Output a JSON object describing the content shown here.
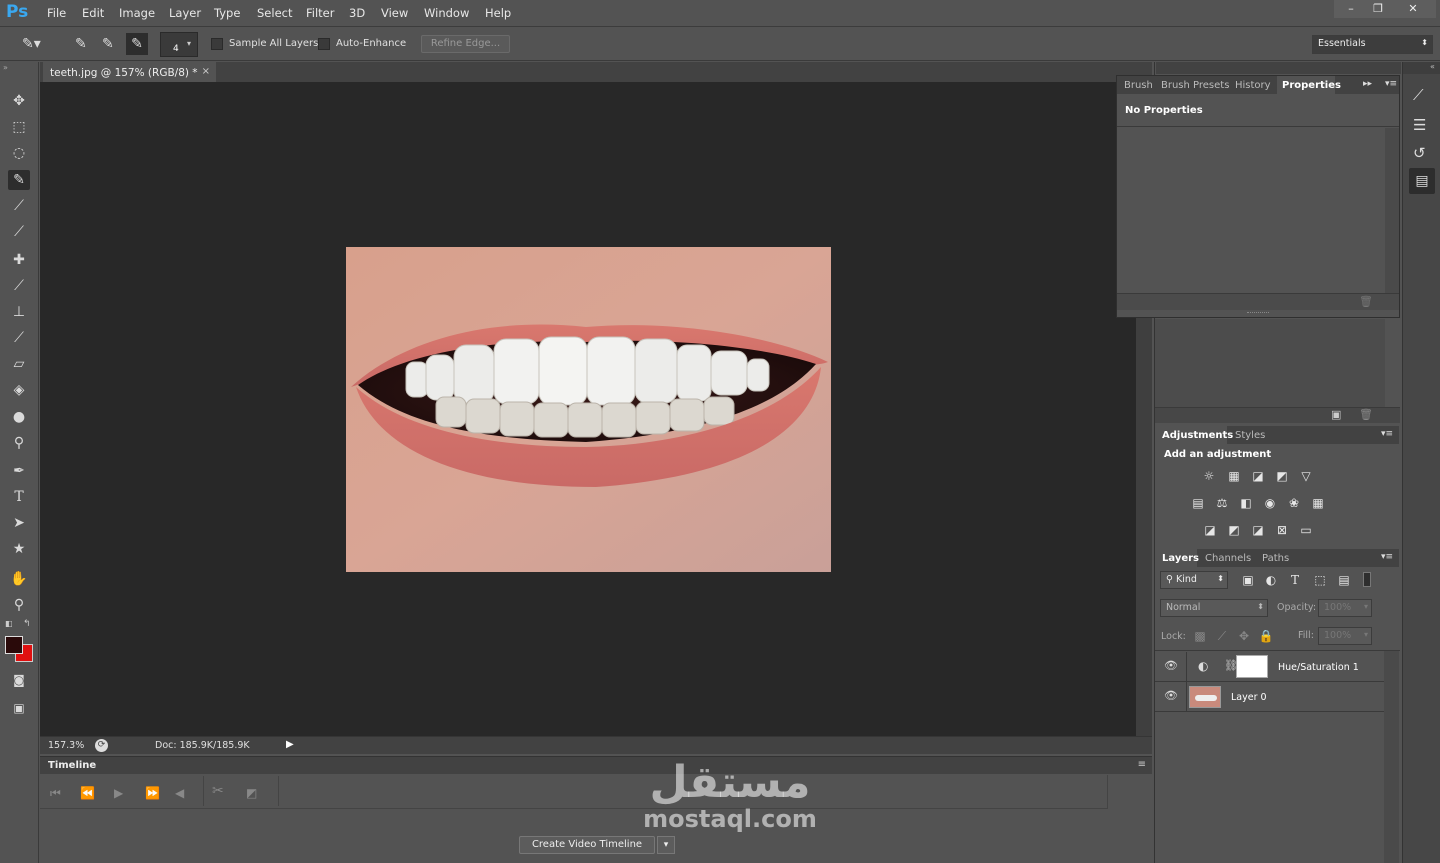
{
  "app": {
    "logo": "Ps"
  },
  "menu": [
    "File",
    "Edit",
    "Image",
    "Layer",
    "Type",
    "Select",
    "Filter",
    "3D",
    "View",
    "Window",
    "Help"
  ],
  "window_controls": {
    "minimize": "–",
    "restore": "❐",
    "close": "✕"
  },
  "options": {
    "brush_size": "4",
    "sample_all_layers": "Sample All Layers",
    "auto_enhance": "Auto-Enhance",
    "refine_edge": "Refine Edge...",
    "workspace": "Essentials"
  },
  "document": {
    "tab_title": "teeth.jpg @ 157% (RGB/8) *",
    "tab_close": "×",
    "zoom": "157.3%",
    "doc_size": "Doc: 185.9K/185.9K"
  },
  "timeline": {
    "title": "Timeline",
    "create_button": "Create Video Timeline"
  },
  "properties_panel": {
    "tabs": [
      "Brush",
      "Brush Presets",
      "History",
      "Properties"
    ],
    "active_tab": "Properties",
    "message": "No Properties"
  },
  "adjustments_panel": {
    "tabs": [
      "Adjustments",
      "Styles"
    ],
    "heading": "Add an adjustment"
  },
  "layers_panel": {
    "tabs": [
      "Layers",
      "Channels",
      "Paths"
    ],
    "kind": "Kind",
    "blend_mode": "Normal",
    "opacity_label": "Opacity:",
    "opacity_value": "100%",
    "lock_label": "Lock:",
    "fill_label": "Fill:",
    "fill_value": "100%",
    "layers": [
      {
        "name": "Hue/Saturation 1"
      },
      {
        "name": "Layer 0"
      }
    ]
  },
  "watermark": {
    "arabic": "مستقل",
    "latin": "mostaql.com"
  },
  "colors": {
    "foreground": "#2a0a0a",
    "background": "#e01010",
    "accent_logo": "#3aa8f0"
  }
}
